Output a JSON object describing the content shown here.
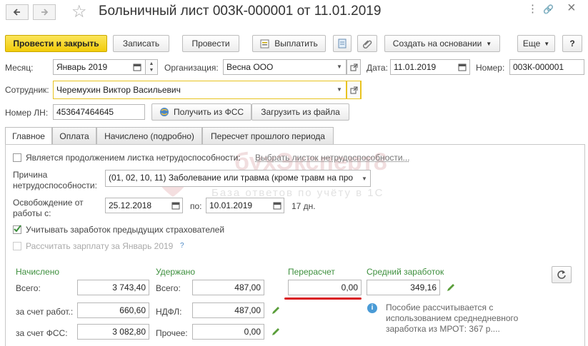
{
  "window": {
    "title": "Больничный лист 003К-000001 от 11.01.2019",
    "more_icon": "⋮",
    "link_icon": "🔗",
    "close_icon": "×"
  },
  "toolbar": {
    "post_close": "Провести и закрыть",
    "save": "Записать",
    "post": "Провести",
    "pay": "Выплатить",
    "create_based": "Создать на основании",
    "more": "Еще",
    "help": "?"
  },
  "header": {
    "month_label": "Месяц:",
    "month_value": "Январь 2019",
    "org_label": "Организация:",
    "org_value": "Весна ООО",
    "date_label": "Дата:",
    "date_value": "11.01.2019",
    "number_label": "Номер:",
    "number_value": "003К-000001",
    "employee_label": "Сотрудник:",
    "employee_value": "Черемухин Виктор Васильевич",
    "ln_label": "Номер ЛН:",
    "ln_value": "453647464645",
    "get_fss": "Получить из ФСС",
    "load_file": "Загрузить из файла"
  },
  "tabs": [
    "Главное",
    "Оплата",
    "Начислено (подробно)",
    "Пересчет прошлого периода"
  ],
  "main": {
    "continuation_label": "Является продолжением листка нетрудоспособности:",
    "continuation_link": "Выбрать листок нетрудоспособности...",
    "reason_label_1": "Причина",
    "reason_label_2": "нетрудоспособности:",
    "reason_value": "(01, 02, 10, 11) Заболевание или травма (кроме травм на про",
    "release_label_1": "Освобождение от",
    "release_label_2": "работы с:",
    "release_from": "25.12.2018",
    "release_to_label": "по:",
    "release_to": "10.01.2019",
    "days": "17 дн.",
    "prev_employers": "Учитывать заработок предыдущих страхователей",
    "calc_salary": "Рассчитать зарплату за Январь 2019",
    "help_mark": "?"
  },
  "totals": {
    "accrued_title": "Начислено",
    "total_label": "Всего:",
    "accrued_total": "3 743,40",
    "employer_label": "за счет работ.:",
    "employer_value": "660,60",
    "fss_label": "за счет ФСС:",
    "fss_value": "3 082,80",
    "withheld_title": "Удержано",
    "withheld_total_label": "Всего:",
    "withheld_total": "487,00",
    "ndfl_label": "НДФЛ:",
    "ndfl_value": "487,00",
    "other_label": "Прочее:",
    "other_value": "0,00",
    "recalc_title": "Перерасчет",
    "recalc_value": "0,00",
    "avg_title": "Средний заработок",
    "avg_value": "349,16",
    "info_text_1": "Пособие рассчитывается с",
    "info_text_2": "использованием среднедневного",
    "info_text_3": "заработка из МРОТ: 367 р...."
  },
  "watermark": {
    "brand": "бухЭксперт8",
    "tagline": "База ответов по учёту в 1С"
  },
  "colors": {
    "primary_button": "#f2cc0a",
    "green_title": "#3d8f3d",
    "highlight_underline": "#d9161c",
    "link": "#777777"
  }
}
